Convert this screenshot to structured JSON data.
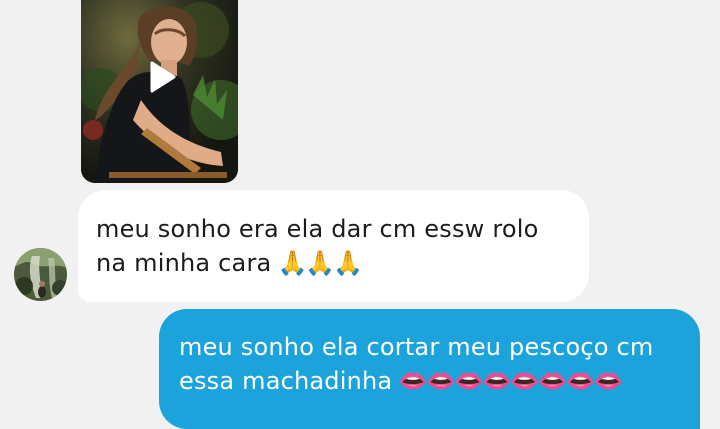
{
  "received_message": {
    "line1": "meu sonho era ela dar cm essw rolo",
    "line2": "na minha cara",
    "emojis": "🙏🙏🙏"
  },
  "sent_message": {
    "line1": "meu sonho ela cortar meu pescoço cm",
    "line2": "essa machadinha",
    "emojis": "👄👄👄👄👄👄👄👄"
  },
  "media": {
    "type": "video",
    "icon": "play-icon"
  },
  "colors": {
    "background": "#f1f1f1",
    "received_bubble": "#ffffff",
    "sent_bubble": "#1ca3dc"
  }
}
